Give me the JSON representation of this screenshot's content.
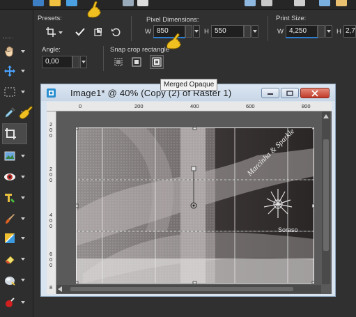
{
  "app": {
    "presets_label": "Presets:",
    "pixel_dimensions_label": "Pixel Dimensions:",
    "print_size_label": "Print Size:",
    "angle_label": "Angle:",
    "snap_label": "Snap crop rectangle",
    "w_label_1": "W",
    "h_label_1": "H",
    "w_label_2": "W",
    "h_label_2": "H",
    "pixel_w": "850",
    "pixel_h": "550",
    "print_w": "4,250",
    "print_h": "2,7",
    "angle_value": "0,00"
  },
  "tooltip": {
    "text": "Merged Opaque"
  },
  "image_window": {
    "title": "Image1* @  40% (Copy (2) of Raster 1)"
  },
  "ruler": {
    "h_ticks": [
      "0",
      "200",
      "400",
      "600",
      "800"
    ],
    "v_ticks": [
      "2",
      "0",
      "0",
      "2",
      "0",
      "0",
      "4",
      "0",
      "0",
      "6",
      "0",
      "0",
      "8"
    ]
  },
  "watermark": {
    "line1": "Marcinha & Sparkle",
    "line2": "Soraso"
  },
  "colors": {
    "accent_blue": "#2f7fd0",
    "hand_pointer": "#f0c020",
    "window_titlebar": "#d0ddeb"
  },
  "icons": {
    "presets": "crop-icon",
    "apply": "checkmark-icon",
    "crop_as_new": "crop-new-icon",
    "reset": "undo-icon",
    "snap_current_layer": "snap-current-layer-icon",
    "snap_opaque": "snap-layer-opaque-icon",
    "snap_merged_opaque": "snap-merged-opaque-icon"
  }
}
